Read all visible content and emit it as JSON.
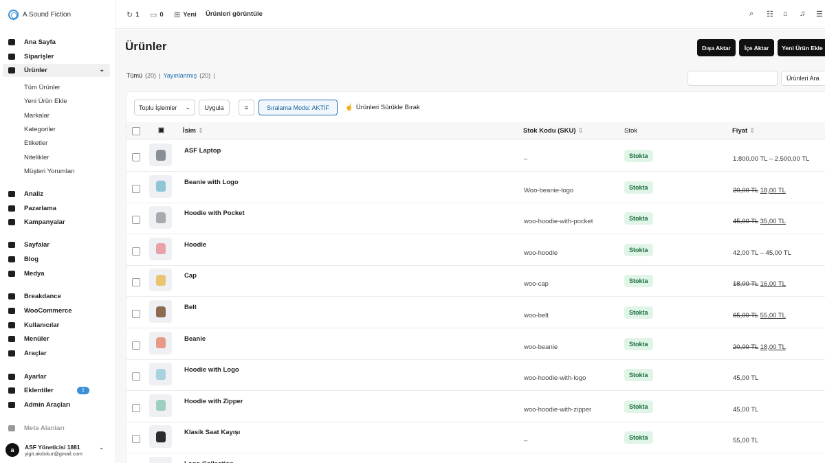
{
  "app": {
    "name": "A Sound Fiction"
  },
  "topbar": {
    "updates": "1",
    "comments": "0",
    "new": "Yeni",
    "view_products": "Ürünleri görüntüle"
  },
  "sidebar": {
    "items": [
      {
        "label": "Ana Sayfa",
        "icon": "home-icon"
      },
      {
        "label": "Siparişler",
        "icon": "inbox-icon"
      },
      {
        "label": "Ürünler",
        "icon": "tag-icon"
      },
      {
        "label": "Analiz",
        "icon": "bar-chart-icon"
      },
      {
        "label": "Pazarlama",
        "icon": "megaphone-icon"
      },
      {
        "label": "Kampanyalar",
        "icon": "gear-badge-icon"
      },
      {
        "label": "Sayfalar",
        "icon": "page-icon"
      },
      {
        "label": "Blog",
        "icon": "pen-icon"
      },
      {
        "label": "Medya",
        "icon": "image-icon"
      },
      {
        "label": "Breakdance",
        "icon": "breakdance-icon"
      },
      {
        "label": "WooCommerce",
        "icon": "woo-icon"
      },
      {
        "label": "Kullanıcılar",
        "icon": "users-icon"
      },
      {
        "label": "Menüler",
        "icon": "grid-icon"
      },
      {
        "label": "Araçlar",
        "icon": "wrench-icon"
      },
      {
        "label": "Ayarlar",
        "icon": "settings-icon"
      },
      {
        "label": "Eklentiler",
        "icon": "plugin-icon",
        "badge": "1"
      },
      {
        "label": "Admin Araçları",
        "icon": "wrench-icon"
      },
      {
        "label": "Meta Alanları",
        "icon": "meta-icon"
      }
    ],
    "subitems": [
      "Tüm Ürünler",
      "Yeni Ürün Ekle",
      "Markalar",
      "Kategoriler",
      "Etiketler",
      "Nitelikler",
      "Müşteri Yorumları"
    ],
    "user": {
      "name": "ASF Yöneticisi 1881",
      "email": "yigit.akdokur@gmail.com",
      "initial": "a"
    }
  },
  "page": {
    "title": "Ürünler",
    "export": "Dışa Aktar",
    "import": "İçe Aktar",
    "add_new": "Yeni Ürün Ekle",
    "filter_all": "Tümü",
    "filter_all_count": "(20)",
    "filter_published": "Yayınlanmış",
    "filter_published_count": "(20)",
    "search_button": "Ürünleri Ara",
    "bulk_actions": "Toplu İşlemler",
    "apply": "Uygula",
    "sort_mode": "Sıralama Modu: AKTİF",
    "drag_drop": "Ürünleri Sürükle Bırak"
  },
  "table": {
    "columns": {
      "name": "İsim",
      "sku": "Stok Kodu (SKU)",
      "stock": "Stok",
      "price": "Fiyat"
    },
    "rows": [
      {
        "name": "ASF Laptop",
        "sku": "–",
        "stock": "Stokta",
        "price": "1.800,00 TL – 2.500,00 TL",
        "old": "",
        "color": "#8a8f96"
      },
      {
        "name": "Beanie with Logo",
        "sku": "Woo-beanie-logo",
        "stock": "Stokta",
        "price": "18,00 TL",
        "old": "20,00 TL",
        "color": "#8ec6d6"
      },
      {
        "name": "Hoodie with Pocket",
        "sku": "woo-hoodie-with-pocket",
        "stock": "Stokta",
        "price": "35,00 TL",
        "old": "45,00 TL",
        "color": "#a9aaae"
      },
      {
        "name": "Hoodie",
        "sku": "woo-hoodie",
        "stock": "Stokta",
        "price": "42,00 TL – 45,00 TL",
        "old": "",
        "color": "#e9a3a8"
      },
      {
        "name": "Cap",
        "sku": "woo-cap",
        "stock": "Stokta",
        "price": "16,00 TL",
        "old": "18,00 TL",
        "color": "#e9c56f"
      },
      {
        "name": "Belt",
        "sku": "woo-belt",
        "stock": "Stokta",
        "price": "55,00 TL",
        "old": "65,00 TL",
        "color": "#8c6a4f"
      },
      {
        "name": "Beanie",
        "sku": "woo-beanie",
        "stock": "Stokta",
        "price": "18,00 TL",
        "old": "20,00 TL",
        "color": "#e99a86"
      },
      {
        "name": "Hoodie with Logo",
        "sku": "woo-hoodie-with-logo",
        "stock": "Stokta",
        "price": "45,00 TL",
        "old": "",
        "color": "#a8d2de"
      },
      {
        "name": "Hoodie with Zipper",
        "sku": "woo-hoodie-with-zipper",
        "stock": "Stokta",
        "price": "45,00 TL",
        "old": "",
        "color": "#9fcfc0"
      },
      {
        "name": "Klasik Saat Kayışı",
        "sku": "–",
        "stock": "Stokta",
        "price": "55,00 TL",
        "old": "",
        "color": "#2b2b2b"
      },
      {
        "name": "Logo Collection",
        "sku": "",
        "stock": "",
        "price": "",
        "old": "",
        "color": "#9fcfe0"
      }
    ]
  }
}
